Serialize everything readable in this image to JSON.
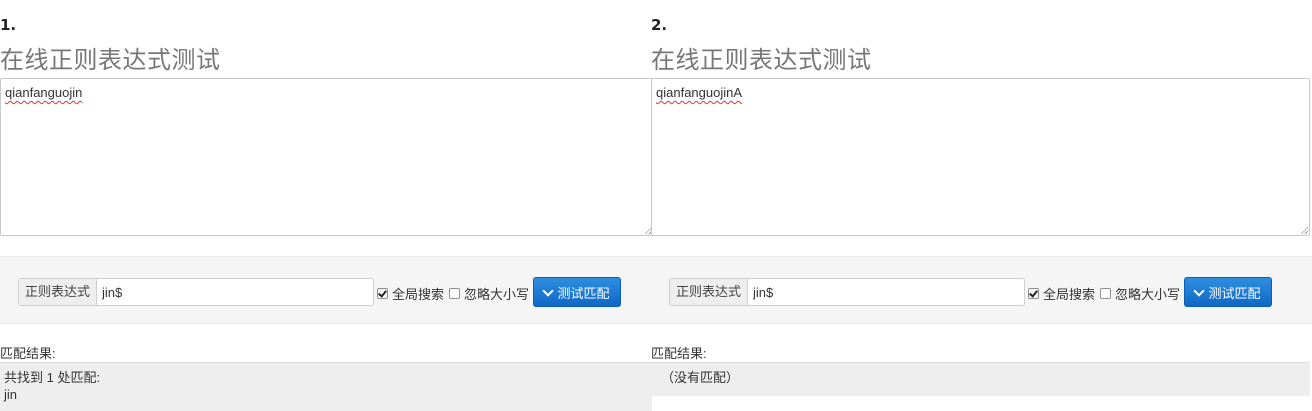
{
  "left": {
    "number": "1.",
    "title": "在线正则表达式测试",
    "text": "qianfanguojin",
    "regex_label": "正则表达式",
    "regex_value": "jin$",
    "global_label": "全局搜索",
    "global_checked": true,
    "ignore_label": "忽略大小写",
    "ignore_checked": false,
    "button_label": "测试匹配",
    "result_label": "匹配结果:",
    "result_line1": "共找到 1 处匹配:",
    "result_line2": "jin"
  },
  "right": {
    "number": "2.",
    "title": "在线正则表达式测试",
    "text": "qianfanguojinA",
    "regex_label": "正则表达式",
    "regex_value": "jin$",
    "global_label": "全局搜索",
    "global_checked": true,
    "ignore_label": "忽略大小写",
    "ignore_checked": false,
    "button_label": "测试匹配",
    "result_label": "匹配结果:",
    "result_line1": "（没有匹配）"
  },
  "icons": {
    "button_icon": "chevron-down-icon"
  },
  "colors": {
    "button": "#1a73d0",
    "toolbar_bg": "#f5f5f5",
    "result_bg": "#eeeeee"
  }
}
